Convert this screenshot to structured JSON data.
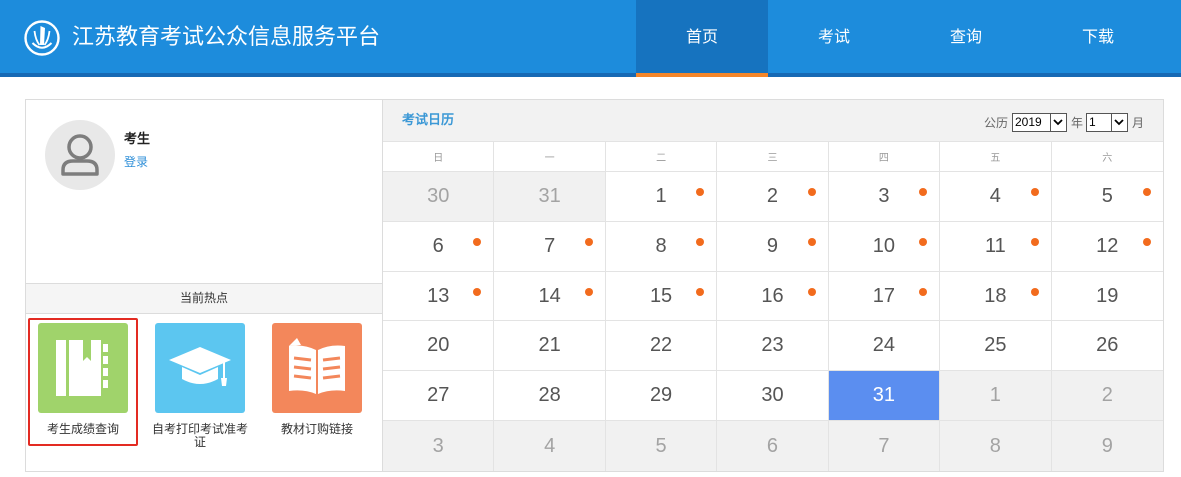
{
  "header": {
    "title": "江苏教育考试公众信息服务平台",
    "logo_icon": "emblem-icon",
    "nav": [
      {
        "label": "首页",
        "active": true
      },
      {
        "label": "考试",
        "active": false
      },
      {
        "label": "查询",
        "active": false
      },
      {
        "label": "下载",
        "active": false
      }
    ]
  },
  "user": {
    "avatar_icon": "user-icon",
    "name": "考生",
    "login_label": "登录"
  },
  "hot": {
    "title": "当前热点",
    "items": [
      {
        "label": "考生成绩查询",
        "icon": "notebook-icon",
        "color": "#a0d36b",
        "highlighted": true
      },
      {
        "label": "自考打印考试准考证",
        "icon": "graduation-cap-icon",
        "color": "#5cc6f0",
        "highlighted": false
      },
      {
        "label": "教材订购链接",
        "icon": "open-book-icon",
        "color": "#f3875b",
        "highlighted": false
      }
    ]
  },
  "calendar": {
    "title": "考试日历",
    "calendar_type_label": "公历",
    "year": "2019",
    "year_label": "年",
    "month": "1",
    "month_label": "月",
    "dropdown_icon": "chevron-down-icon",
    "weekdays": [
      "日",
      "一",
      "二",
      "三",
      "四",
      "五",
      "六"
    ],
    "weeks": [
      [
        {
          "day": 30,
          "other_month": true
        },
        {
          "day": 31,
          "other_month": true
        },
        {
          "day": 1,
          "exam": true
        },
        {
          "day": 2,
          "exam": true
        },
        {
          "day": 3,
          "exam": true
        },
        {
          "day": 4,
          "exam": true
        },
        {
          "day": 5,
          "exam": true
        }
      ],
      [
        {
          "day": 6,
          "exam": true
        },
        {
          "day": 7,
          "exam": true
        },
        {
          "day": 8,
          "exam": true
        },
        {
          "day": 9,
          "exam": true
        },
        {
          "day": 10,
          "exam": true
        },
        {
          "day": 11,
          "exam": true
        },
        {
          "day": 12,
          "exam": true
        }
      ],
      [
        {
          "day": 13,
          "exam": true
        },
        {
          "day": 14,
          "exam": true
        },
        {
          "day": 15,
          "exam": true
        },
        {
          "day": 16,
          "exam": true
        },
        {
          "day": 17,
          "exam": true
        },
        {
          "day": 18,
          "exam": true
        },
        {
          "day": 19
        }
      ],
      [
        {
          "day": 20
        },
        {
          "day": 21
        },
        {
          "day": 22
        },
        {
          "day": 23
        },
        {
          "day": 24
        },
        {
          "day": 25
        },
        {
          "day": 26
        }
      ],
      [
        {
          "day": 27
        },
        {
          "day": 28
        },
        {
          "day": 29
        },
        {
          "day": 30
        },
        {
          "day": 31,
          "selected": true
        },
        {
          "day": 1,
          "other_month": true
        },
        {
          "day": 2,
          "other_month": true
        }
      ],
      [
        {
          "day": 3,
          "other_month": true
        },
        {
          "day": 4,
          "other_month": true
        },
        {
          "day": 5,
          "other_month": true
        },
        {
          "day": 6,
          "other_month": true
        },
        {
          "day": 7,
          "other_month": true
        },
        {
          "day": 8,
          "other_month": true
        },
        {
          "day": 9,
          "other_month": true
        }
      ]
    ]
  },
  "colors": {
    "header_bg": "#1d8cdc",
    "header_stripe": "#1769b4",
    "nav_active_bg": "#1673bf",
    "nav_active_underline": "#f4862a",
    "login_link": "#2f8fd8",
    "calendar_title": "#3b98d6",
    "exam_dot": "#f26b1d",
    "selected_day": "#5b8ef0",
    "hot_highlight": "#e32b22"
  }
}
